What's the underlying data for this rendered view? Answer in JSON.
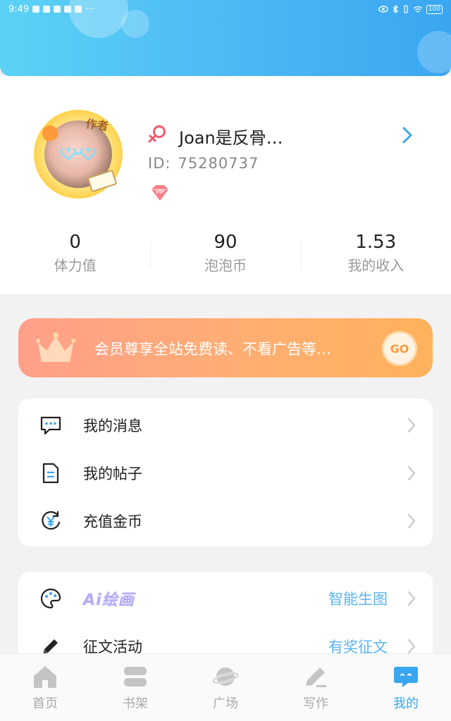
{
  "status_bar": {
    "time": "9:49",
    "more": "···",
    "battery": "100"
  },
  "profile": {
    "nickname": "Joan是反骨…",
    "id_label": "ID:",
    "id_value": "75280737",
    "author_tag": "作者",
    "vip_badge": "VIP",
    "gender_color": "#f05a6e"
  },
  "stats": [
    {
      "value": "0",
      "label": "体力值"
    },
    {
      "value": "90",
      "label": "泡泡币"
    },
    {
      "value": "1.53",
      "label": "我的收入"
    }
  ],
  "vip_banner": {
    "text": "会员尊享全站免费读、不看广告等…",
    "button": "GO"
  },
  "menu_group_1": [
    {
      "label": "我的消息",
      "icon": "message-icon"
    },
    {
      "label": "我的帖子",
      "icon": "document-icon"
    },
    {
      "label": "充值金币",
      "icon": "yen-coin-icon"
    }
  ],
  "menu_group_2": [
    {
      "label": "Ai绘画",
      "right": "智能生图",
      "icon": "palette-icon"
    },
    {
      "label": "征文活动",
      "right": "有奖征文",
      "icon": "pencil-icon"
    }
  ],
  "tabs": [
    {
      "label": "首页",
      "icon": "home-icon",
      "active": false
    },
    {
      "label": "书架",
      "icon": "bookshelf-icon",
      "active": false
    },
    {
      "label": "广场",
      "icon": "planet-icon",
      "active": false
    },
    {
      "label": "写作",
      "icon": "write-icon",
      "active": false
    },
    {
      "label": "我的",
      "icon": "profile-bubble-icon",
      "active": true
    }
  ],
  "colors": {
    "accent": "#39a6ef",
    "header_gradient_start": "#5cd2f6",
    "header_gradient_end": "#3aa6f1",
    "vip_gradient_start": "#ff9f8a",
    "vip_gradient_end": "#ffb25c",
    "secondary_text": "#999999"
  }
}
